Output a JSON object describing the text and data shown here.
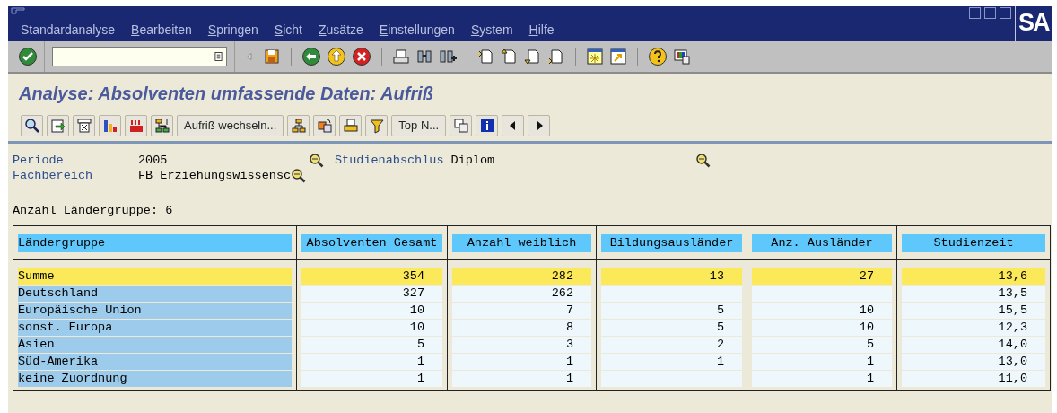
{
  "menu_bar": {
    "items": [
      {
        "label": "Standardanalyse",
        "mnemonic": false
      },
      {
        "label": "Bearbeiten",
        "mnemonic": true
      },
      {
        "label": "Springen",
        "mnemonic": true
      },
      {
        "label": "Sicht",
        "mnemonic": true
      },
      {
        "label": "Zusätze",
        "mnemonic": true
      },
      {
        "label": "Einstellungen",
        "mnemonic": true
      },
      {
        "label": "System",
        "mnemonic": true
      },
      {
        "label": "Hilfe",
        "mnemonic": true
      }
    ],
    "logo": "SA"
  },
  "title": "Analyse: Absolventen umfassende Daten: Aufriß",
  "app_toolbar": {
    "buttons": [
      {
        "label": "Aufriß wechseln..."
      },
      {
        "label": "Top N..."
      }
    ]
  },
  "header_fields": [
    {
      "label": "Periode",
      "value": "2005"
    },
    {
      "label": "Studienabschlus",
      "value": "Diplom"
    },
    {
      "label": "Fachbereich",
      "value": "FB Erziehungswissensc"
    }
  ],
  "count_line": "Anzahl Ländergruppe: 6",
  "table": {
    "columns": [
      {
        "label": "Ländergruppe"
      },
      {
        "label": "Absolventen Gesamt"
      },
      {
        "label": "Anzahl weiblich"
      },
      {
        "label": "Bildungsausländer"
      },
      {
        "label": "Anz. Ausländer"
      },
      {
        "label": "Studienzeit"
      }
    ],
    "rows": [
      {
        "kind": "total",
        "cells": [
          "Summe",
          "354",
          "282",
          "13",
          "27",
          "13,6"
        ]
      },
      {
        "kind": "detail",
        "cells": [
          "Deutschland",
          "327",
          "262",
          "",
          "",
          "13,5"
        ]
      },
      {
        "kind": "detail",
        "cells": [
          "Europäische Union",
          "10",
          "7",
          "5",
          "10",
          "15,5"
        ]
      },
      {
        "kind": "detail",
        "cells": [
          "sonst. Europa",
          "10",
          "8",
          "5",
          "10",
          "12,3"
        ]
      },
      {
        "kind": "detail",
        "cells": [
          "Asien",
          "5",
          "3",
          "2",
          "5",
          "14,0"
        ]
      },
      {
        "kind": "detail",
        "cells": [
          "Süd-Amerika",
          "1",
          "1",
          "1",
          "1",
          "13,0"
        ]
      },
      {
        "kind": "detail",
        "cells": [
          "keine Zuordnung",
          "1",
          "1",
          "",
          "1",
          "11,0"
        ]
      }
    ]
  }
}
